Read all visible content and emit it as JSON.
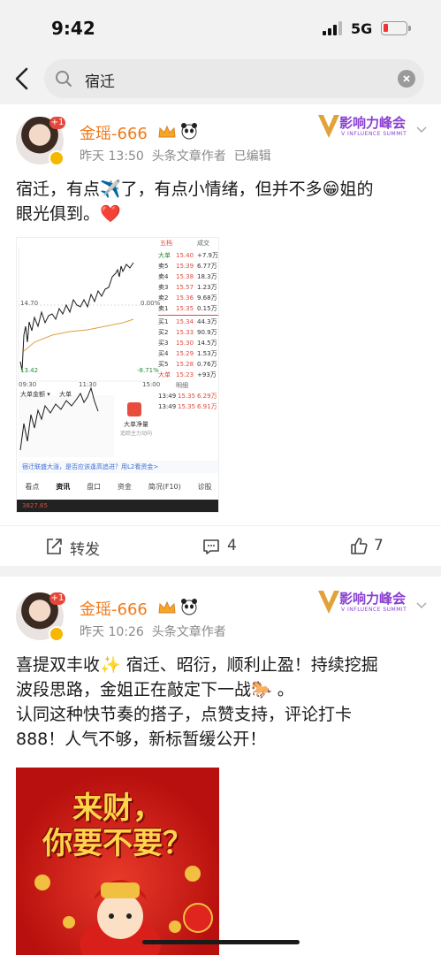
{
  "status": {
    "time": "9:42",
    "network": "5G"
  },
  "search": {
    "query": "宿迁"
  },
  "posts": [
    {
      "username": "金瑶-666",
      "avatar_badge": "+1",
      "time": "昨天 13:50",
      "author_type": "头条文章作者",
      "edited": "已编辑",
      "brand": "影响力峰会",
      "brand_sub": "V INFLUENCE SUMMIT",
      "text_line1": "宿迁，有点✈️了，有点小情绪，但并不多😁姐的",
      "text_line2": "眼光俱到。❤️",
      "stock": {
        "top_tab": "五档",
        "top_tab2": "成交",
        "big_buy": "大单",
        "big_buy_price": "15.40",
        "big_buy_vol": "+7.9万",
        "price_high": "14.70",
        "pct_mid": "0.00%",
        "price_low": "13.42",
        "pct_low": "-8.71%",
        "time_start": "09:30",
        "time_mid": "11:30",
        "time_end": "15:00",
        "asks": [
          {
            "label": "卖5",
            "price": "15.39",
            "vol": "6.77万"
          },
          {
            "label": "卖4",
            "price": "15.38",
            "vol": "18.3万"
          },
          {
            "label": "卖3",
            "price": "15.57",
            "vol": "1.23万"
          },
          {
            "label": "卖2",
            "price": "15.36",
            "vol": "9.68万"
          },
          {
            "label": "卖1",
            "price": "15.35",
            "vol": "0.15万"
          }
        ],
        "bids": [
          {
            "label": "买1",
            "price": "15.34",
            "vol": "44.3万"
          },
          {
            "label": "买2",
            "price": "15.33",
            "vol": "90.9万"
          },
          {
            "label": "买3",
            "price": "15.30",
            "vol": "14.5万"
          },
          {
            "label": "买4",
            "price": "15.29",
            "vol": "1.53万"
          },
          {
            "label": "买5",
            "price": "15.28",
            "vol": "0.76万"
          }
        ],
        "big_sell": "大单",
        "big_sell_price": "15.23",
        "big_sell_vol": "+93万",
        "detail_label": "明细",
        "trades": [
          {
            "t": "13:49",
            "p": "15.35",
            "v": "6.29万"
          },
          {
            "t": "13:49",
            "p": "15.35",
            "v": "6.91万"
          }
        ],
        "sub_left": "大单金额 ▾",
        "sub_right": "大单",
        "promo_title": "大单净量",
        "promo_sub": "追踪主力动向",
        "banner": "宿迁联盛大涨，是否应该逢高追进？用L2看资金>",
        "tabs": [
          "看点",
          "资讯",
          "盘口",
          "资金",
          "简况(F10)",
          "诊股"
        ],
        "footer_price": "3827.65"
      },
      "actions": {
        "forward": "转发",
        "comments": "4",
        "likes": "7"
      }
    },
    {
      "username": "金瑶-666",
      "avatar_badge": "+1",
      "time": "昨天 10:26",
      "author_type": "头条文章作者",
      "brand": "影响力峰会",
      "brand_sub": "V INFLUENCE SUMMIT",
      "text_line1": "喜提双丰收✨ 宿迁、昭衍，顺利止盈！持续挖掘",
      "text_line2": "波段思路，金姐正在敲定下一战🐎 。",
      "text_line3": "认同这种快节奏的搭子，点赞支持，评论打卡",
      "text_line4": "888！人气不够，新标暂缓公开！",
      "poster_line1": "来财，",
      "poster_line2": "你要不要？"
    }
  ]
}
